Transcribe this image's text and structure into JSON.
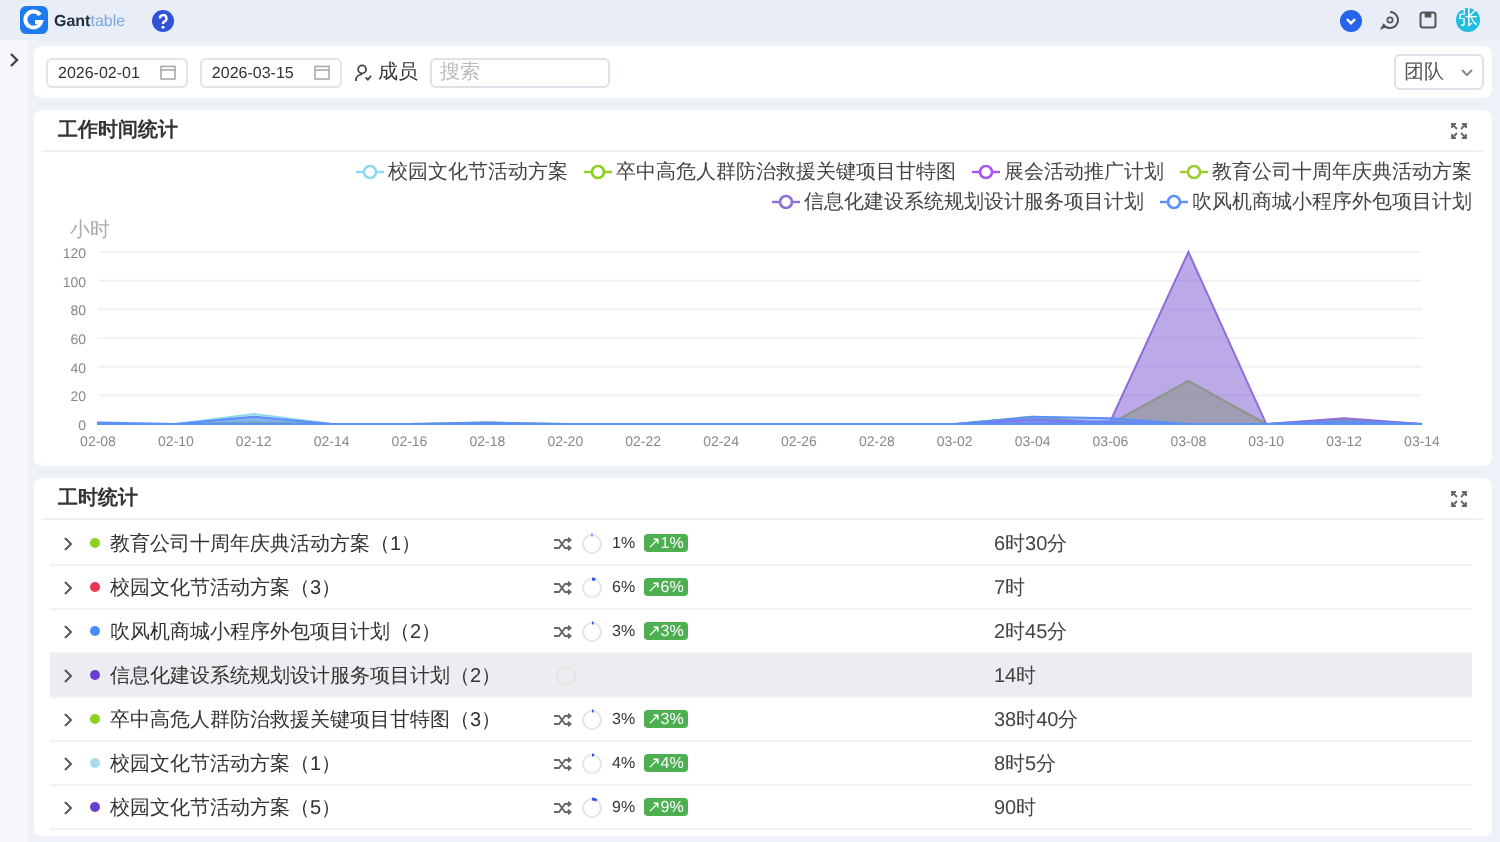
{
  "header": {
    "brand_prefix": "Gant",
    "brand_suffix": "table",
    "avatar": "张"
  },
  "filters": {
    "start_date": "2026-02-01",
    "end_date": "2026-03-15",
    "member_label": "成员",
    "search_placeholder": "搜索",
    "group_by": "团队"
  },
  "chart_card": {
    "title": "工作时间统计",
    "chart_data": {
      "type": "area",
      "ylabel": "小时",
      "stacked": false,
      "categories": [
        "02-08",
        "02-10",
        "02-12",
        "02-14",
        "02-16",
        "02-18",
        "02-20",
        "02-22",
        "02-24",
        "02-26",
        "02-28",
        "03-02",
        "03-04",
        "03-06",
        "03-08",
        "03-10",
        "03-12",
        "03-14"
      ],
      "yticks": [
        0,
        20,
        40,
        60,
        80,
        100,
        120
      ],
      "ylim": [
        0,
        120
      ],
      "grid": true,
      "series": [
        {
          "name": "校园文化节活动方案",
          "color": "#8fd8f0",
          "values": [
            0,
            0,
            7,
            0,
            0,
            0,
            0,
            0,
            0,
            0,
            0,
            0,
            0,
            0,
            0,
            0,
            0,
            0
          ]
        },
        {
          "name": "卒中高危人群防治救援关键项目甘特图",
          "color": "#8ccf1c",
          "values": [
            0,
            0,
            0,
            0,
            0,
            0,
            0,
            0,
            0,
            0,
            0,
            0,
            5,
            0,
            30,
            0,
            3,
            0
          ]
        },
        {
          "name": "展会活动推广计划",
          "color": "#a855f7",
          "values": [
            0,
            0,
            0,
            0,
            0,
            0,
            0,
            0,
            0,
            0,
            0,
            0,
            3,
            1,
            0,
            0,
            0,
            0
          ]
        },
        {
          "name": "教育公司十周年庆典活动方案",
          "color": "#9acd32",
          "values": [
            0,
            0,
            1,
            0,
            0,
            1,
            0,
            0,
            0,
            0,
            0,
            0,
            0,
            0,
            0,
            0,
            0,
            0
          ]
        },
        {
          "name": "信息化建设系统规划设计服务项目计划",
          "color": "#8e6fd8",
          "values": [
            0,
            0,
            0,
            0,
            0,
            0,
            0,
            0,
            0,
            0,
            0,
            0,
            0,
            2,
            120,
            0,
            4,
            0
          ]
        },
        {
          "name": "吹风机商城小程序外包项目计划",
          "color": "#5b8ff9",
          "values": [
            1,
            0,
            5,
            0,
            0,
            1,
            0,
            0,
            0,
            0,
            0,
            0,
            5,
            4,
            0,
            0,
            2,
            0
          ]
        }
      ]
    }
  },
  "table_card": {
    "title": "工时统计",
    "rows": [
      {
        "name": "教育公司十周年庆典活动方案（1）",
        "color": "#8ccf1c",
        "selected": false,
        "level": 0.01,
        "percent": "1%",
        "change": "↗1%",
        "hours": "6时30分"
      },
      {
        "name": "校园文化节活动方案（3）",
        "color": "#e8384f",
        "selected": false,
        "level": 0.06,
        "percent": "6%",
        "change": "↗6%",
        "hours": "7时"
      },
      {
        "name": "吹风机商城小程序外包项目计划（2）",
        "color": "#4a8cf7",
        "selected": false,
        "level": 0.03,
        "percent": "3%",
        "change": "↗3%",
        "hours": "2时45分"
      },
      {
        "name": "信息化建设系统规划设计服务项目计划（2）",
        "color": "#6a3fd0",
        "selected": true,
        "hours": "14时"
      },
      {
        "name": "卒中高危人群防治救援关键项目甘特图（3）",
        "color": "#8ccf1c",
        "selected": false,
        "level": 0.03,
        "percent": "3%",
        "change": "↗3%",
        "hours": "38时40分"
      },
      {
        "name": "校园文化节活动方案（1）",
        "color": "#a5dcf2",
        "selected": false,
        "level": 0.04,
        "percent": "4%",
        "change": "↗4%",
        "hours": "8时5分"
      },
      {
        "name": "校园文化节活动方案（5）",
        "color": "#6a3fd0",
        "selected": false,
        "level": 0.09,
        "percent": "9%",
        "change": "↗9%",
        "hours": "90时"
      }
    ]
  }
}
